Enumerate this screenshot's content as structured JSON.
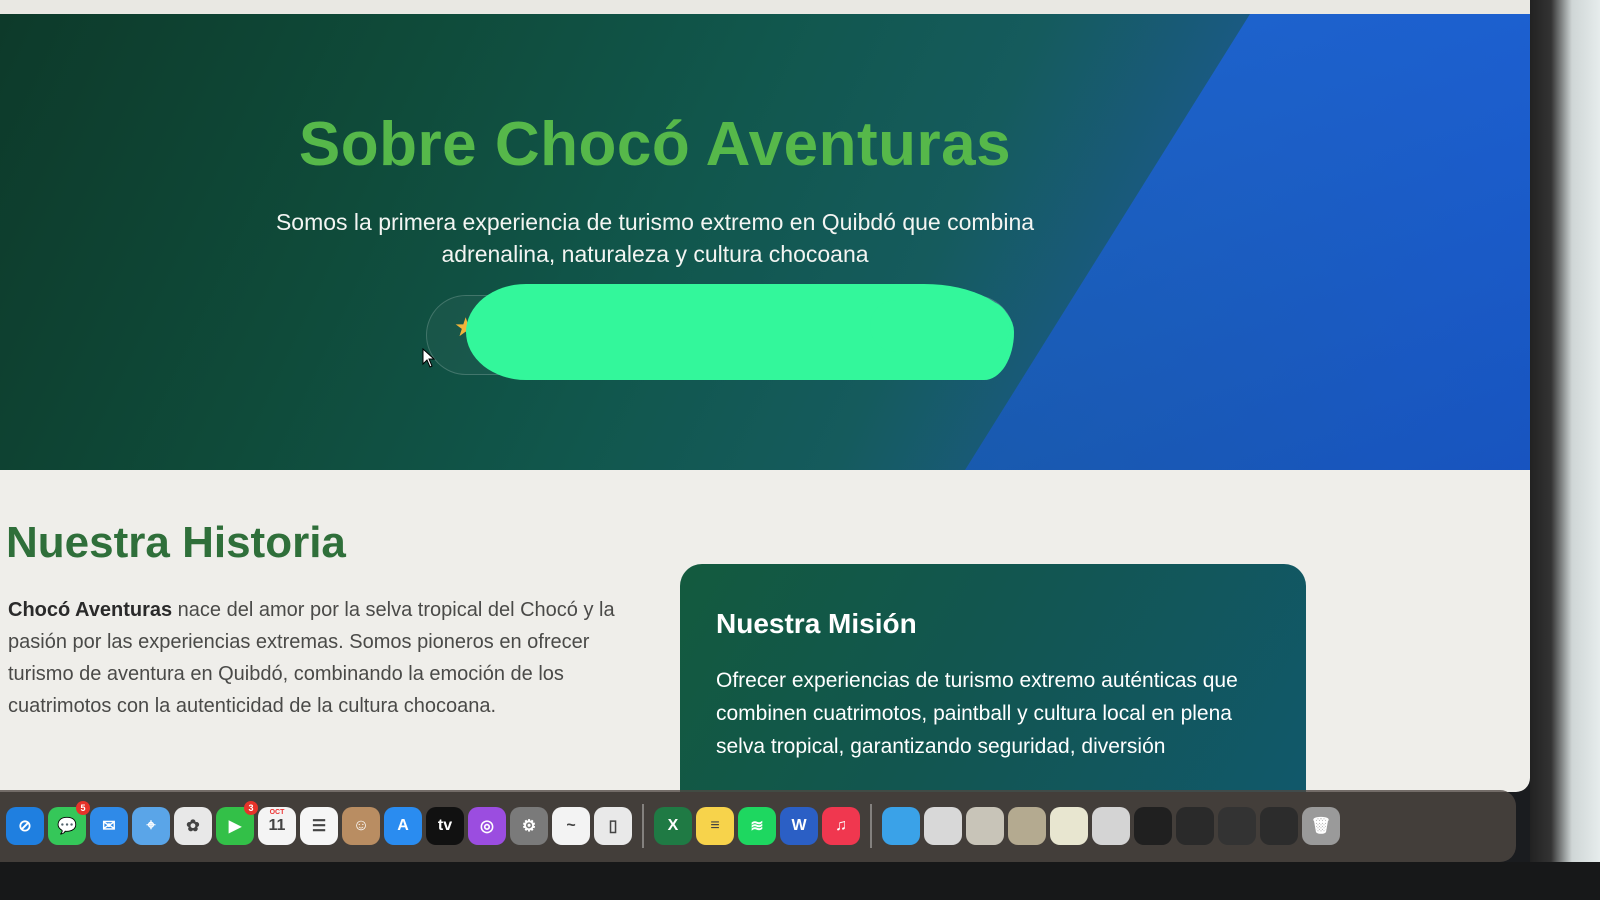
{
  "hero": {
    "title": "Sobre Chocó Aventuras",
    "subtitle": "Somos la primera experiencia de turismo extremo en Quibdó que combina adrenalina, naturaleza y cultura chocoana",
    "badge_icon": "star-icon",
    "title_color": "#56b84a"
  },
  "history": {
    "title": "Nuestra Historia",
    "bold_lead": "Chocó Aventuras",
    "text": " nace del amor por la selva tropical del Chocó y la pasión por las experiencias extremas. Somos pioneros en ofrecer turismo de aventura en Quibdó, combinando la emoción de los cuatrimotos con la autenticidad de la cultura chocoana."
  },
  "mission": {
    "title": "Nuestra Misión",
    "text": "Ofrecer experiencias de turismo extremo auténticas que combinen cuatrimotos, paintball y cultura local en plena selva tropical, garantizando seguridad, diversión"
  },
  "dock": {
    "apps": [
      {
        "icon": "safari-icon",
        "color": "#1f7fe0",
        "glyph": "⊘"
      },
      {
        "icon": "messages-icon",
        "color": "#35c759",
        "glyph": "💬",
        "badge": "5"
      },
      {
        "icon": "mail-icon",
        "color": "#2f8ae8",
        "glyph": "✉"
      },
      {
        "icon": "maps-icon",
        "color": "#5aa5e8",
        "glyph": "⌖"
      },
      {
        "icon": "photos-icon",
        "color": "#e8e8e8",
        "glyph": "✿"
      },
      {
        "icon": "facetime-icon",
        "color": "#33c048",
        "glyph": "▶",
        "badge": "3"
      },
      {
        "icon": "calendar-icon",
        "color": "#f4f4f4",
        "glyph": "11",
        "label": "OCT"
      },
      {
        "icon": "reminders-icon",
        "color": "#f6f6f6",
        "glyph": "☰"
      },
      {
        "icon": "contacts-icon",
        "color": "#b98d62",
        "glyph": "☺"
      },
      {
        "icon": "app-store-icon",
        "color": "#2a8cf0",
        "glyph": "A"
      },
      {
        "icon": "apple-tv-icon",
        "color": "#111111",
        "glyph": "tv"
      },
      {
        "icon": "podcasts-icon",
        "color": "#9b4de0",
        "glyph": "◎"
      },
      {
        "icon": "settings-icon",
        "color": "#7a7a7a",
        "glyph": "⚙"
      },
      {
        "icon": "freeform-icon",
        "color": "#f3f3f3",
        "glyph": "~"
      },
      {
        "icon": "iphone-mirroring-icon",
        "color": "#e9e9e9",
        "glyph": "▯"
      }
    ],
    "apps2": [
      {
        "icon": "excel-icon",
        "color": "#1f7a44",
        "glyph": "X"
      },
      {
        "icon": "notes-icon",
        "color": "#f7d34b",
        "glyph": "≡"
      },
      {
        "icon": "spotify-icon",
        "color": "#1ed760",
        "glyph": "≋"
      },
      {
        "icon": "word-icon",
        "color": "#2b5fc5",
        "glyph": "W"
      },
      {
        "icon": "music-icon",
        "color": "#f0374f",
        "glyph": "♫"
      }
    ],
    "apps3": [
      {
        "icon": "folder-icon",
        "color": "#3aa2e8",
        "glyph": ""
      },
      {
        "icon": "window-thumbnail-icon",
        "color": "#d8d8d8",
        "glyph": ""
      },
      {
        "icon": "window-thumbnail-icon",
        "color": "#c8c4b8",
        "glyph": ""
      },
      {
        "icon": "window-thumbnail-icon",
        "color": "#b4aa90",
        "glyph": ""
      },
      {
        "icon": "window-thumbnail-icon",
        "color": "#e8e6d0",
        "glyph": ""
      },
      {
        "icon": "window-thumbnail-icon",
        "color": "#d4d4d4",
        "glyph": ""
      },
      {
        "icon": "window-thumbnail-icon",
        "color": "#202020",
        "glyph": ""
      },
      {
        "icon": "window-thumbnail-icon",
        "color": "#2a2a2a",
        "glyph": ""
      },
      {
        "icon": "window-thumbnail-icon",
        "color": "#333333",
        "glyph": ""
      },
      {
        "icon": "window-thumbnail-icon",
        "color": "#2c2c2c",
        "glyph": ""
      },
      {
        "icon": "trash-icon",
        "color": "#9a9a9a",
        "glyph": "🗑"
      }
    ]
  }
}
